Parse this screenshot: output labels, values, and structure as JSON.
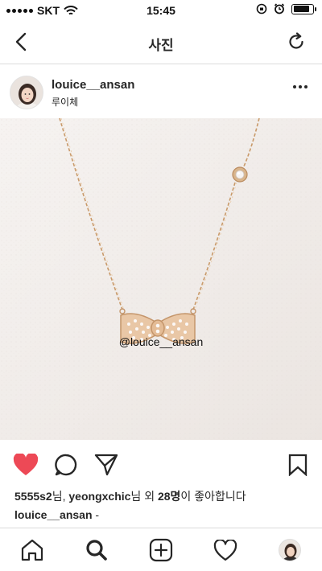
{
  "status_bar": {
    "carrier": "SKT",
    "time": "15:45",
    "battery_level": 0.85
  },
  "nav": {
    "title": "사진",
    "back_icon": "chevron-left-icon",
    "refresh_icon": "refresh-icon"
  },
  "post": {
    "username": "louice__ansan",
    "location": "루이체",
    "more_icon": "more-horizontal-icon",
    "image_watermark": "@louice__ansan",
    "liked": true,
    "likes": {
      "user1": "5555s2",
      "suffix1": "님, ",
      "user2": "yeongxchic",
      "suffix2": "님 외 ",
      "count": "28명",
      "suffix3": "이 좋아합니다"
    },
    "caption": {
      "username": "louice__ansan",
      "text": " -"
    }
  },
  "colors": {
    "like_red": "#ed4956",
    "text": "#262626",
    "divider": "#dbdbdb"
  },
  "tab_bar": {
    "items": [
      "home-icon",
      "search-icon",
      "add-post-icon",
      "activity-heart-icon",
      "profile-avatar"
    ]
  }
}
